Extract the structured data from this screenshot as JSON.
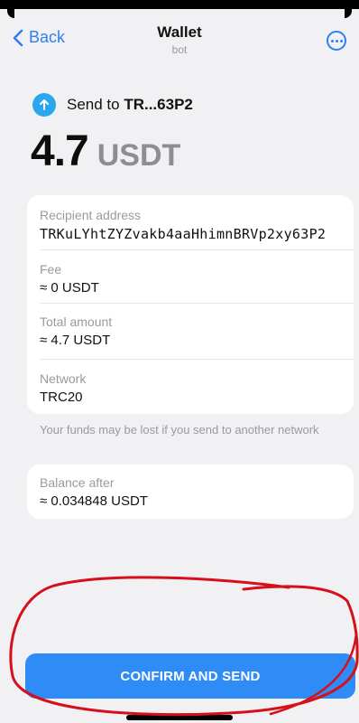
{
  "nav": {
    "back_label": "Back",
    "title": "Wallet",
    "subtitle": "bot"
  },
  "send": {
    "prefix": "Send to ",
    "recipient_short": "TR...63P2"
  },
  "amount": {
    "value": "4.7",
    "unit": "USDT"
  },
  "details": [
    {
      "label": "Recipient address",
      "value": "TRKuLYhtZYZvakb4aaHhimnBRVp2xy63P2"
    },
    {
      "label": "Fee",
      "value": "≈ 0 USDT"
    },
    {
      "label": "Total amount",
      "value": "≈ 4.7 USDT"
    },
    {
      "label": "Network",
      "value": "TRC20"
    }
  ],
  "warning": "Your funds may be lost if you send to another network",
  "balance_after": {
    "label": "Balance after",
    "value": "≈ 0.034848 USDT"
  },
  "confirm_label": "CONFIRM AND SEND",
  "colors": {
    "accent": "#2f7ef5",
    "button": "#2f8bf5",
    "send_icon": "#2ba7ee",
    "annotation": "#d6101b"
  },
  "icons": {
    "back": "chevron-left-icon",
    "more": "more-dots-icon",
    "send": "arrow-up-icon"
  }
}
